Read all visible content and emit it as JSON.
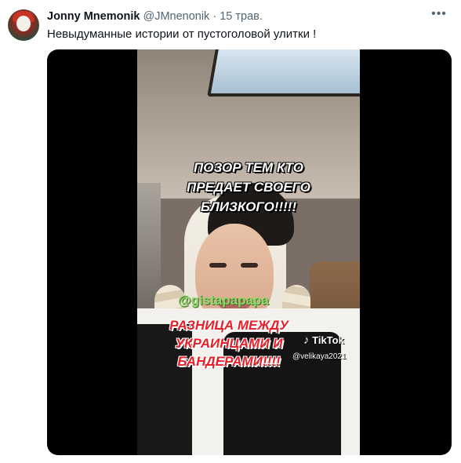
{
  "tweet": {
    "author_name": "Jonny Mnemonik",
    "handle": "@JMnenonik",
    "separator": "·",
    "date": "15 трав.",
    "more_icon": "more-horizontal-icon",
    "text": "Невыдуманные истории от пустоголовой улитки !"
  },
  "video": {
    "caption_top_lines": [
      "ПОЗОР ТЕМ  КТО",
      "ПРЕДАЕТ СВОЕГО",
      "БЛИЗКОГО!!!!!"
    ],
    "overlay_handle": "@gistapapapa",
    "caption_bottom_lines": [
      "РАЗНИЦА  МЕЖДУ",
      "УКРАИНЦАМИ  И",
      "БАНДЕРАМИ!!!!"
    ],
    "tiktok_label": "TikTok",
    "tiktok_icon": "tiktok-note-icon",
    "tiktok_user": "@velikaya2021",
    "colors": {
      "top_caption": "#ffffff",
      "handle": "#8fd66b",
      "bottom_caption": "#e8202a"
    }
  }
}
